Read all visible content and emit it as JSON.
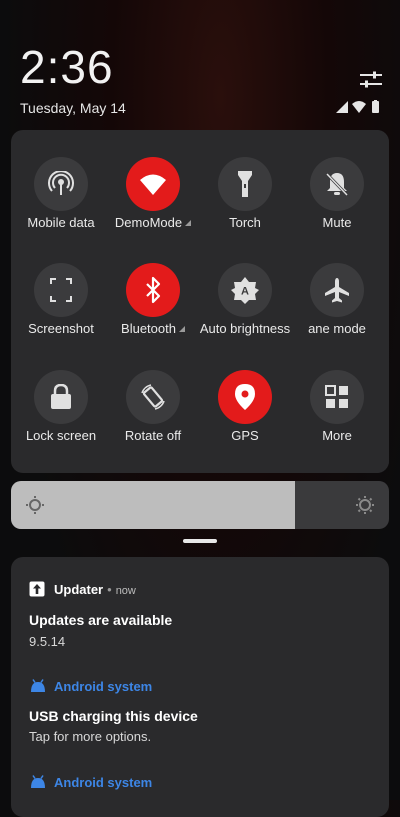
{
  "status": {
    "time": "2:36",
    "date": "Tuesday, May 14"
  },
  "quick_settings": [
    {
      "label": "Mobile data",
      "icon": "mobile-data-icon",
      "active": false,
      "has_caret": false
    },
    {
      "label": "DemoMode",
      "icon": "wifi-icon",
      "active": true,
      "has_caret": true
    },
    {
      "label": "Torch",
      "icon": "flashlight-icon",
      "active": false,
      "has_caret": false
    },
    {
      "label": "Mute",
      "icon": "mute-bell-icon",
      "active": false,
      "has_caret": false
    },
    {
      "label": "Screenshot",
      "icon": "screenshot-icon",
      "active": false,
      "has_caret": false
    },
    {
      "label": "Bluetooth",
      "icon": "bluetooth-icon",
      "active": true,
      "has_caret": true
    },
    {
      "label": "Auto brightness",
      "icon": "auto-brightness-icon",
      "active": false,
      "has_caret": false
    },
    {
      "label": "ane mode",
      "icon": "airplane-icon",
      "active": false,
      "has_caret": false
    },
    {
      "label": "Lock screen",
      "icon": "lock-icon",
      "active": false,
      "has_caret": false
    },
    {
      "label": "Rotate off",
      "icon": "rotate-icon",
      "active": false,
      "has_caret": false
    },
    {
      "label": "GPS",
      "icon": "location-icon",
      "active": true,
      "has_caret": false
    },
    {
      "label": "More",
      "icon": "grid-icon",
      "active": false,
      "has_caret": false
    }
  ],
  "brightness": {
    "level": 0.75
  },
  "notifications": {
    "updater": {
      "app": "Updater",
      "time": "now",
      "title": "Updates are available",
      "text": "9.5.14"
    },
    "usb": {
      "app": "Android system",
      "title": "USB charging this device",
      "text": "Tap for more options."
    },
    "android2": {
      "app": "Android system"
    }
  },
  "colors": {
    "accent_red": "#e31b1b",
    "link_blue": "#3d86e6"
  }
}
